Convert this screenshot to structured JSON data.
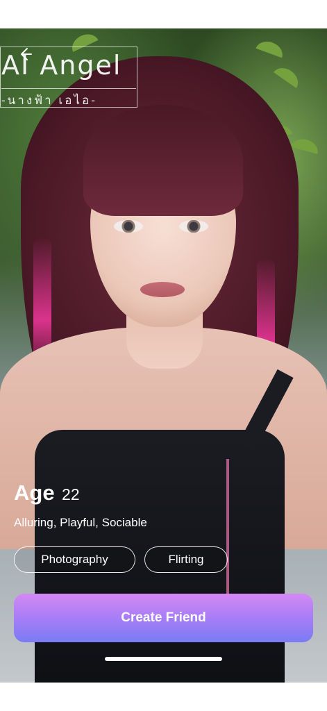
{
  "header": {
    "back_icon": "arrow-left-icon",
    "title": "AI Angel",
    "subtitle": "-นางฟ้า เอไอ-"
  },
  "profile": {
    "age_label": "Age",
    "age_value": "22",
    "traits": "Alluring, Playful, Sociable",
    "interests": [
      "Photography",
      "Flirting"
    ]
  },
  "actions": {
    "create_label": "Create Friend"
  },
  "colors": {
    "cta_gradient_top": "#d389f4",
    "cta_gradient_bottom": "#7a7cf3",
    "text": "#ffffff"
  }
}
